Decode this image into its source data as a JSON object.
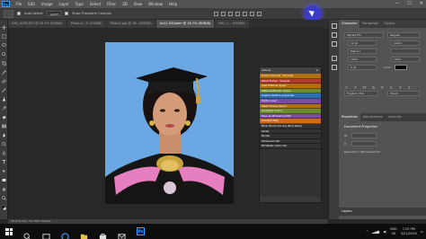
{
  "menubar": {
    "logo": "Ps",
    "items": [
      "File",
      "Edit",
      "Image",
      "Layer",
      "Type",
      "Select",
      "Filter",
      "3D",
      "View",
      "Window",
      "Help"
    ],
    "controls": [
      "—",
      "☐",
      "✕"
    ]
  },
  "options": {
    "auto_select_label": "Auto-Select:",
    "auto_select_value": "Layer",
    "transform_label": "Show Transform Controls"
  },
  "tabs": [
    "DSC_4090.JPG @ 16.7% (RGB/8)",
    "Photo-4...% (RGB/8)",
    "Photo2.jpg @ 16...(RGB/8)",
    "Ax12 GS0adm @ 16.7% (RGB/8)",
    "DSC_1... (RGB/8)"
  ],
  "status": "16.67%     Doc: 34.7M/3.7M/less",
  "actions": {
    "title": "Actions",
    "rows": [
      {
        "label": "Frame Channel - 50 pixel",
        "color": "#b0710b"
      },
      {
        "label": "Wood Frame - 50 pixel",
        "color": "#b43b31"
      },
      {
        "label": "Cast Shadow (type)",
        "color": "#b0710b"
      },
      {
        "label": "Water Reflection (type)",
        "color": "#6e8b2f"
      },
      {
        "label": "Custom RGB to Grayscale",
        "color": "#2f6fb0"
      },
      {
        "label": "Molten Lead",
        "color": "#7b4ca0"
      },
      {
        "label": "Sepia Toning (layer)",
        "color": "#b0710b"
      },
      {
        "label": "Quadrant Colors",
        "color": "#6e8b2f"
      },
      {
        "label": "Save as Photoshop PDF",
        "color": "#7b4ca0"
      },
      {
        "label": "Gradient Map",
        "color": "#d16a10"
      },
      {
        "label": "Mixer Brush Cloning Paint Setup",
        "color": "#323232"
      },
      {
        "label": "akxka",
        "color": "#323232"
      },
      {
        "label": "Border",
        "color": "#323232"
      },
      {
        "label": "Stroke+border",
        "color": "#323232"
      },
      {
        "label": "PP Master Action 02",
        "color": "#323232"
      }
    ]
  },
  "character": {
    "tabs": [
      "Character",
      "Paragraph",
      "Glyphs"
    ],
    "font": "Myriad Pro",
    "style": "Regular",
    "size": "12 pt",
    "leading": "(Auto)",
    "tracking": "Metrics",
    "scale": "100%",
    "baseline": "0 pt",
    "color_label": "Color:",
    "typestyle": [
      "T",
      "T",
      "TT",
      "Tr",
      "T'",
      "T,",
      "T",
      "T"
    ],
    "language": "English: USA",
    "aa": "Sharp"
  },
  "properties": {
    "tabs": [
      "Properties",
      "Adjustments",
      "Libraries"
    ],
    "doc_title": "Document Properties",
    "w_label": "W:",
    "h_label": "H:",
    "res": "Resolution: 300 pixels/inch"
  },
  "layers_title": "Layers",
  "taskbar": {
    "ps": "Ps",
    "lang": "ENG",
    "region": "US",
    "time": "7:25 PM",
    "date": "3/21/2019"
  }
}
